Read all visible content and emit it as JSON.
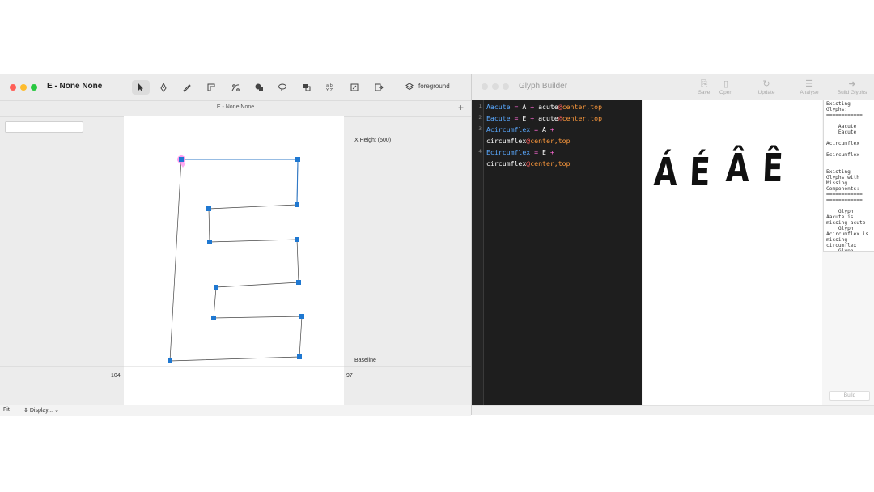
{
  "editor": {
    "window_title": "E - None None",
    "tab_title": "E - None None",
    "layer_label": "foreground",
    "x_height_label": "X Height (500)",
    "baseline_label": "Baseline",
    "left_margin": "104",
    "right_margin": "97",
    "zoom_label": "Fit",
    "display_label": "Display...",
    "search_value": "",
    "tools": [
      "pointer-tool",
      "bezier-tool",
      "pen-tool",
      "ruler-tool",
      "knife-tool",
      "shapes-tool",
      "lasso-tool",
      "components-tool",
      "transform-tool",
      "edit-tool",
      "export-tool"
    ],
    "colors": {
      "selection": "#2f79c7",
      "point": "#1f78d1",
      "start_point": "#ff44dd"
    }
  },
  "builder": {
    "window_title": "Glyph Builder",
    "toolbar": [
      {
        "label": "Save",
        "icon": "save-icon"
      },
      {
        "label": "Open",
        "icon": "open-icon"
      },
      {
        "label": "Update",
        "icon": "refresh-icon"
      },
      {
        "label": "Analyse",
        "icon": "analyse-icon"
      },
      {
        "label": "Build Glyphs",
        "icon": "arrow-right-icon"
      }
    ],
    "code_lines": [
      {
        "num": "1",
        "name": "Aacute",
        "eq": " = ",
        "base": "A",
        "plus": " + ",
        "accent": "acute",
        "at": "@",
        "anchor": "center,top"
      },
      {
        "num": "2",
        "name": "Eacute",
        "eq": " = ",
        "base": "E",
        "plus": " + ",
        "accent": "acute",
        "at": "@",
        "anchor": "center,top"
      },
      {
        "num": "3",
        "name": "Acircumflex",
        "eq": " = ",
        "base": "A",
        "plus": " +",
        "accent": "circumflex",
        "at": "@",
        "anchor": "center,top"
      },
      {
        "num": "4",
        "name": "Ecircumflex",
        "eq": " = ",
        "base": "E",
        "plus": " +",
        "accent": "circumflex",
        "at": "@",
        "anchor": "center,top"
      }
    ],
    "preview_glyphs": [
      "Á",
      "É",
      "Â",
      "Ê"
    ],
    "report_text": "Existing\nGlyphs:\n============\n-\n    Aacute\n    Eacute\n\nAcircumflex\n\nEcircumflex\n\n\nExisting\nGlyphs with\nMissing\nComponents:\n============\n============\n------\n    Glyph\nAacute is\nmissing acute\n    Glyph\nAcircumflex is\nmissing\ncircumflex\n    Glyph",
    "build_label": "Build"
  }
}
